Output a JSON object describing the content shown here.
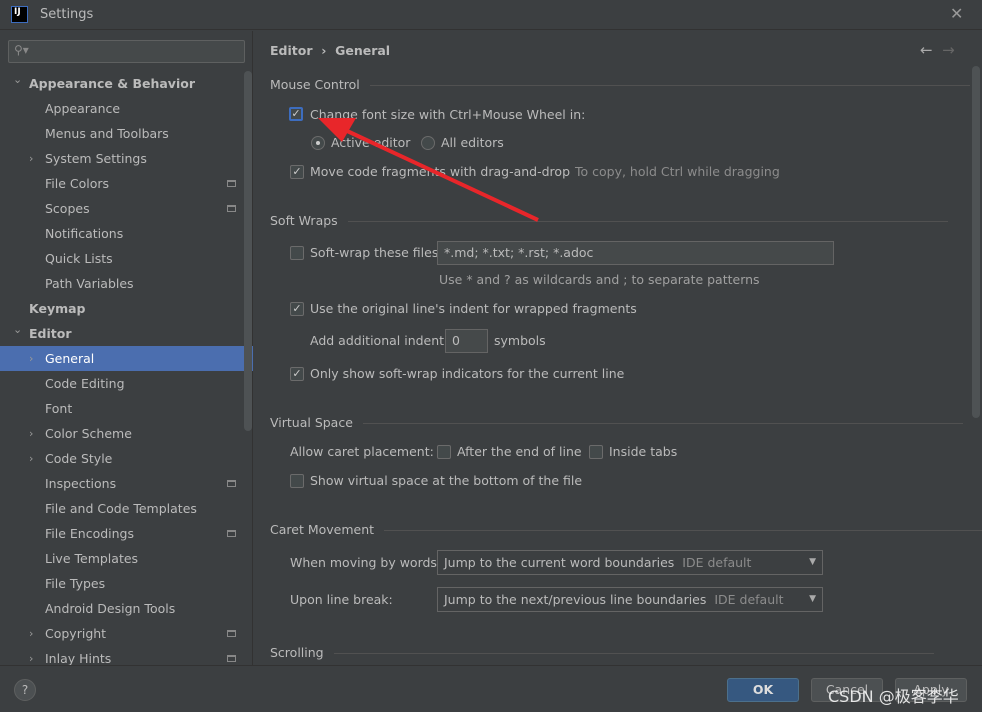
{
  "window": {
    "title": "Settings",
    "logo": "IJ"
  },
  "search": {
    "placeholder": "",
    "icon": "search-icon"
  },
  "tree": [
    {
      "label": "Appearance & Behavior",
      "level": 0,
      "chevron": "down",
      "bold": true
    },
    {
      "label": "Appearance",
      "level": 1
    },
    {
      "label": "Menus and Toolbars",
      "level": 1
    },
    {
      "label": "System Settings",
      "level": 1,
      "chevron": "right"
    },
    {
      "label": "File Colors",
      "level": 1,
      "cfg": true
    },
    {
      "label": "Scopes",
      "level": 1,
      "cfg": true
    },
    {
      "label": "Notifications",
      "level": 1
    },
    {
      "label": "Quick Lists",
      "level": 1
    },
    {
      "label": "Path Variables",
      "level": 1
    },
    {
      "label": "Keymap",
      "level": 0,
      "bold": true
    },
    {
      "label": "Editor",
      "level": 0,
      "chevron": "down",
      "bold": true
    },
    {
      "label": "General",
      "level": 1,
      "chevron": "right",
      "selected": true
    },
    {
      "label": "Code Editing",
      "level": 1
    },
    {
      "label": "Font",
      "level": 1
    },
    {
      "label": "Color Scheme",
      "level": 1,
      "chevron": "right"
    },
    {
      "label": "Code Style",
      "level": 1,
      "chevron": "right"
    },
    {
      "label": "Inspections",
      "level": 1,
      "cfg": true
    },
    {
      "label": "File and Code Templates",
      "level": 1
    },
    {
      "label": "File Encodings",
      "level": 1,
      "cfg": true
    },
    {
      "label": "Live Templates",
      "level": 1
    },
    {
      "label": "File Types",
      "level": 1
    },
    {
      "label": "Android Design Tools",
      "level": 1
    },
    {
      "label": "Copyright",
      "level": 1,
      "chevron": "right",
      "cfg": true
    },
    {
      "label": "Inlay Hints",
      "level": 1,
      "chevron": "right",
      "cfg": true
    }
  ],
  "breadcrumb": {
    "parent": "Editor",
    "sep": "›",
    "current": "General"
  },
  "mouse": {
    "title": "Mouse Control",
    "ctrl_wheel": "Change font size with Ctrl+Mouse Wheel in:",
    "ctrl_wheel_checked": true,
    "active_editor": "Active editor",
    "all_editors": "All editors",
    "selected": "Active editor",
    "drag": "Move code fragments with drag-and-drop",
    "drag_checked": true,
    "drag_hint": "To copy, hold Ctrl while dragging"
  },
  "wraps": {
    "title": "Soft Wraps",
    "softwrap": "Soft-wrap these files:",
    "softwrap_checked": false,
    "patterns": "*.md; *.txt; *.rst; *.adoc",
    "patterns_hint": "Use * and ? as wildcards and ; to separate patterns",
    "indent": "Use the original line's indent for wrapped fragments",
    "indent_checked": true,
    "add_indent": "Add additional indent:",
    "add_indent_value": "0",
    "symbols": "symbols",
    "indicators": "Only show soft-wrap indicators for the current line",
    "indicators_checked": true
  },
  "virtual": {
    "title": "Virtual Space",
    "caret": "Allow caret placement:",
    "after_end": "After the end of line",
    "inside_tabs": "Inside tabs",
    "show_bottom": "Show virtual space at the bottom of the file"
  },
  "caret": {
    "title": "Caret Movement",
    "words_label": "When moving by words:",
    "words_value": "Jump to the current word boundaries",
    "words_hint": "IDE default",
    "break_label": "Upon line break:",
    "break_value": "Jump to the next/previous line boundaries",
    "break_hint": "IDE default"
  },
  "scrolling": {
    "title": "Scrolling"
  },
  "footer": {
    "help": "?",
    "ok": "OK",
    "cancel": "Cancel",
    "apply": "Apply"
  },
  "watermark": "CSDN @极客李华",
  "colors": {
    "selection": "#4b6eaf",
    "annotation_arrow": "#e8262a",
    "ok_button": "#365880"
  }
}
